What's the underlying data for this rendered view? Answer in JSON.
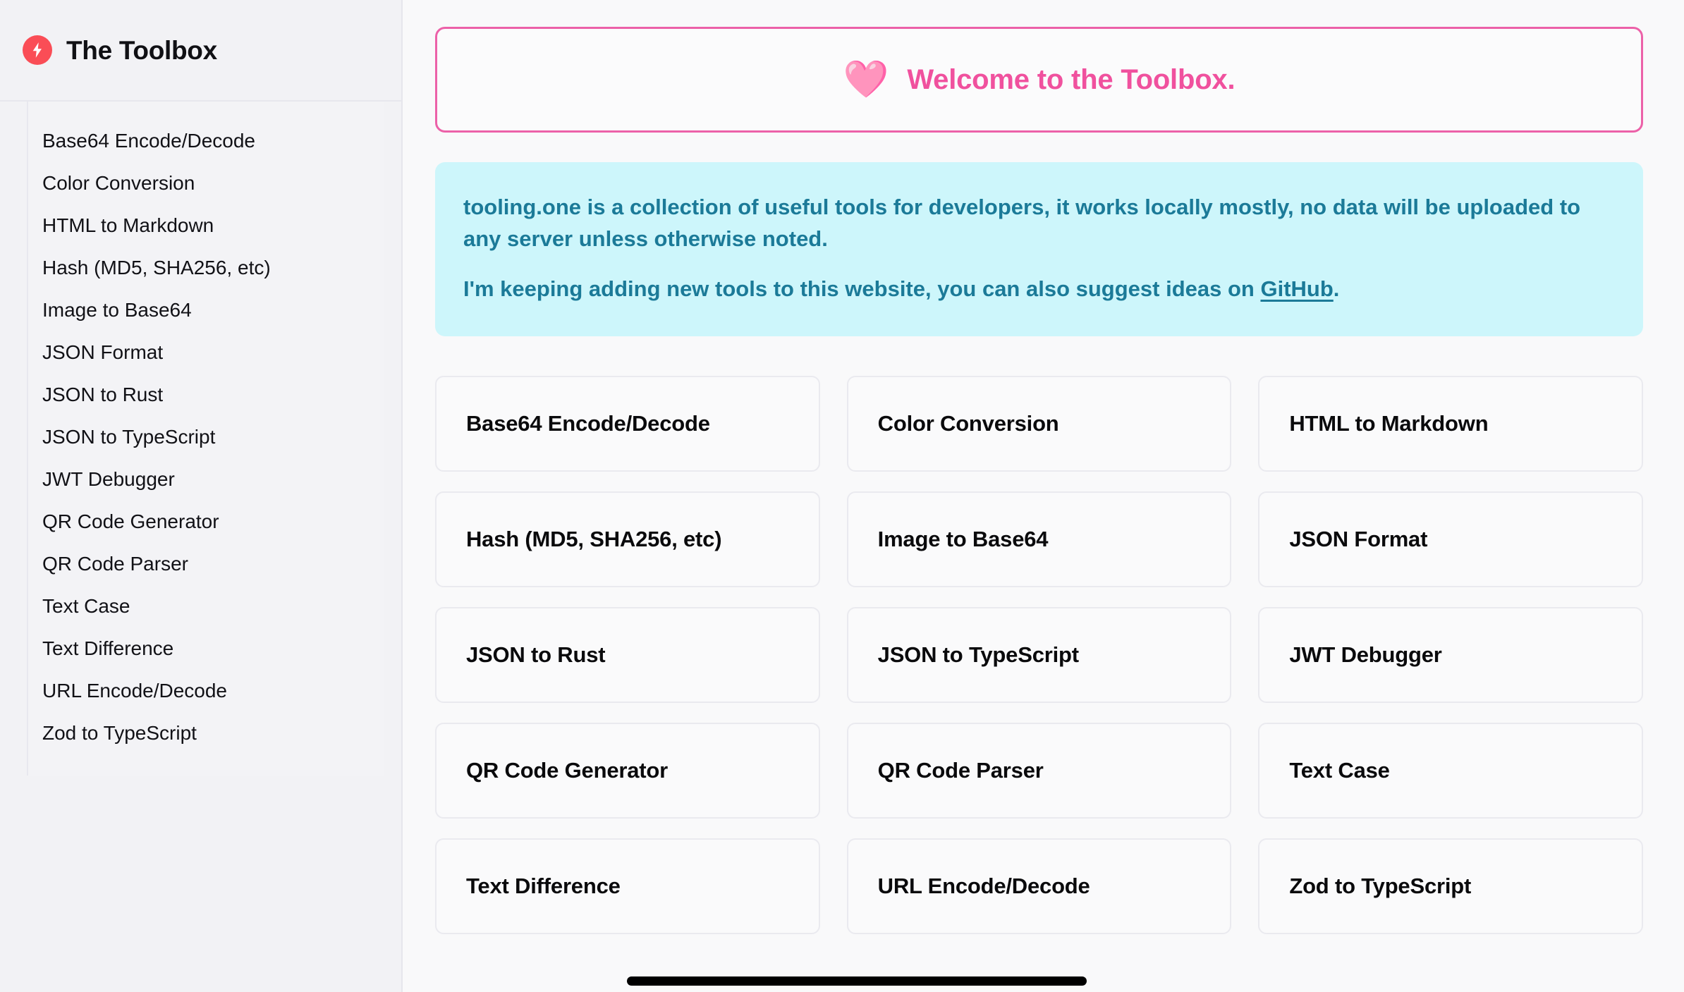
{
  "sidebar": {
    "brand": {
      "title": "The Toolbox",
      "icon": "lightning-bolt-icon",
      "icon_color": "#fa4d56"
    },
    "items": [
      {
        "label": "Base64 Encode/Decode"
      },
      {
        "label": "Color Conversion"
      },
      {
        "label": "HTML to Markdown"
      },
      {
        "label": "Hash (MD5, SHA256, etc)"
      },
      {
        "label": "Image to Base64"
      },
      {
        "label": "JSON Format"
      },
      {
        "label": "JSON to Rust"
      },
      {
        "label": "JSON to TypeScript"
      },
      {
        "label": "JWT Debugger"
      },
      {
        "label": "QR Code Generator"
      },
      {
        "label": "QR Code Parser"
      },
      {
        "label": "Text Case"
      },
      {
        "label": "Text Difference"
      },
      {
        "label": "URL Encode/Decode"
      },
      {
        "label": "Zod to TypeScript"
      }
    ]
  },
  "main": {
    "welcome": {
      "emoji": "🩷",
      "emoji_name": "cat-holding-pink-heart-emoji",
      "text": "Welcome to the Toolbox.",
      "text_color": "#f0519e",
      "border_color": "#ec61a8"
    },
    "info": {
      "background_color": "#cdf6fb",
      "text_color": "#1b7a98",
      "paragraph1": "tooling.one is a collection of useful tools for developers, it works locally mostly, no data will be uploaded to any server unless otherwise noted.",
      "paragraph2_before": "I'm keeping adding new tools to this website, you can also suggest ideas on ",
      "paragraph2_link": "GitHub",
      "paragraph2_after": "."
    },
    "cards": [
      {
        "label": "Base64 Encode/Decode"
      },
      {
        "label": "Color Conversion"
      },
      {
        "label": "HTML to Markdown"
      },
      {
        "label": "Hash (MD5, SHA256, etc)"
      },
      {
        "label": "Image to Base64"
      },
      {
        "label": "JSON Format"
      },
      {
        "label": "JSON to Rust"
      },
      {
        "label": "JSON to TypeScript"
      },
      {
        "label": "JWT Debugger"
      },
      {
        "label": "QR Code Generator"
      },
      {
        "label": "QR Code Parser"
      },
      {
        "label": "Text Case"
      },
      {
        "label": "Text Difference"
      },
      {
        "label": "URL Encode/Decode"
      },
      {
        "label": "Zod to TypeScript"
      }
    ]
  },
  "scrollbar": {
    "orientation": "horizontal",
    "thumb_color": "#000000"
  }
}
